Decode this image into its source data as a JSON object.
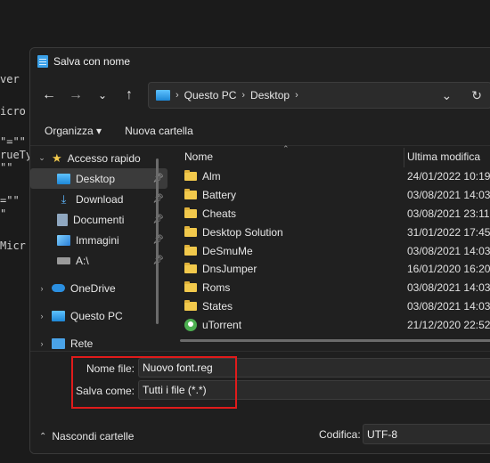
{
  "background_text": {
    "line1": "ver",
    "line2": "icro",
    "line3": "\"=\"\"",
    "line4": "rueTy",
    "line5": "\"\"",
    "line6": "=\"\"",
    "line7": "\"",
    "line8": "Micr"
  },
  "dialog": {
    "title": "Salva con nome"
  },
  "nav": {
    "back_icon": "←",
    "forward_icon": "→",
    "recent_icon": "⌄",
    "up_icon": "↑",
    "breadcrumb": [
      "Questo PC",
      "Desktop"
    ],
    "dropdown_icon": "⌄",
    "refresh_icon": "↻"
  },
  "toolbar": {
    "organize": "Organizza ▾",
    "new_folder": "Nuova cartella"
  },
  "sidebar": {
    "items": [
      {
        "label": "Accesso rapido",
        "icon": "star-icon"
      },
      {
        "label": "Desktop",
        "icon": "desktop-icon"
      },
      {
        "label": "Download",
        "icon": "download-icon"
      },
      {
        "label": "Documenti",
        "icon": "documents-icon"
      },
      {
        "label": "Immagini",
        "icon": "images-icon"
      },
      {
        "label": "A:\\",
        "icon": "drive-icon"
      },
      {
        "label": "OneDrive",
        "icon": "cloud-icon"
      },
      {
        "label": "Questo PC",
        "icon": "pc-icon"
      },
      {
        "label": "Rete",
        "icon": "network-icon"
      }
    ]
  },
  "columns": {
    "name": "Nome",
    "modified": "Ultima modifica"
  },
  "files": [
    {
      "name": "Alm",
      "date": "24/01/2022 10:19"
    },
    {
      "name": "Battery",
      "date": "03/08/2021 14:03"
    },
    {
      "name": "Cheats",
      "date": "03/08/2021 23:11"
    },
    {
      "name": "Desktop Solution",
      "date": "31/01/2022 17:45"
    },
    {
      "name": "DeSmuMe",
      "date": "03/08/2021 14:03"
    },
    {
      "name": "DnsJumper",
      "date": "16/01/2020 16:20"
    },
    {
      "name": "Roms",
      "date": "03/08/2021 14:03"
    },
    {
      "name": "States",
      "date": "03/08/2021 14:03"
    },
    {
      "name": "uTorrent",
      "date": "21/12/2020 22:52"
    }
  ],
  "form": {
    "filename_label": "Nome file:",
    "filename_value": "Nuovo font.reg",
    "savetype_label": "Salva come:",
    "savetype_value": "Tutti i file  (*.*)",
    "hide_folders": "Nascondi cartelle",
    "encoding_label": "Codifica:",
    "encoding_value": "UTF-8"
  },
  "colors": {
    "highlight": "#e01b1b",
    "accent": "#3aa0e8",
    "folder": "#f2c94c"
  }
}
